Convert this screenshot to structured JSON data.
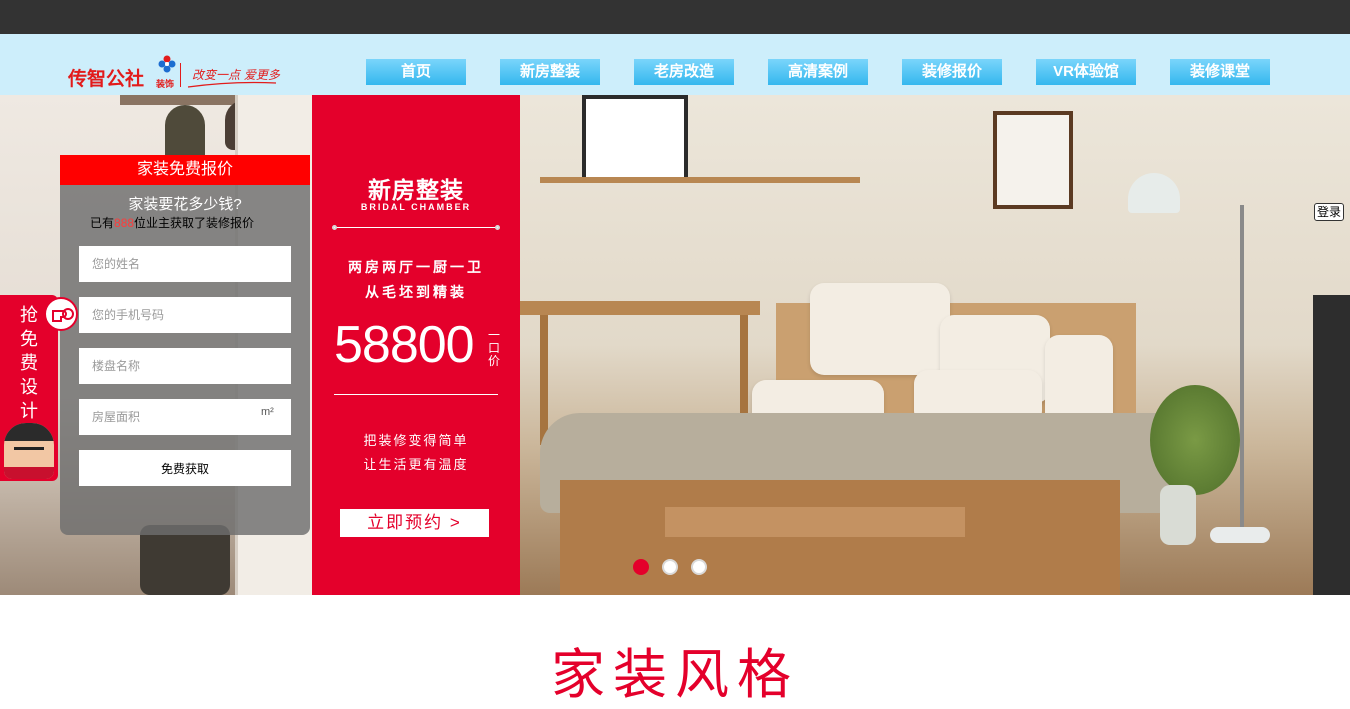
{
  "logo": {
    "brand": "传智公社",
    "sub": "装饰",
    "slogan": "改变一点 爱更多"
  },
  "nav": {
    "items": [
      "首页",
      "新房整装",
      "老房改造",
      "高清案例",
      "装修报价",
      "VR体验馆",
      "装修课堂"
    ]
  },
  "quote_form": {
    "title": "家装免费报价",
    "question": "家装要花多少钱?",
    "note_prefix": "已有",
    "note_count": "888",
    "note_suffix": "位业主获取了装修报价",
    "name_placeholder": "您的姓名",
    "phone_placeholder": "您的手机号码",
    "building_placeholder": "楼盘名称",
    "area_placeholder": "房屋面积",
    "area_unit": "m²",
    "submit_label": "免费获取"
  },
  "side_left": {
    "text": "抢免费设计"
  },
  "promo": {
    "title": "新房整装",
    "subtitle": "BRIDAL CHAMBER",
    "desc_line1": "两房两厅一厨一卫",
    "desc_line2": "从毛坯到精装",
    "price": "58800",
    "price_unit": "一口价",
    "slogan_line1": "把装修变得简单",
    "slogan_line2": "让生活更有温度",
    "cta_label": "立即预约 >"
  },
  "carousel": {
    "active_index": 0,
    "count": 3
  },
  "side_right": {
    "login_label": "登录"
  },
  "section": {
    "title": "家装风格"
  },
  "colors": {
    "brand_red": "#e4002b",
    "nav_blue": "#34b7ee",
    "header_bg": "#cdeefb",
    "topbar": "#333333"
  }
}
